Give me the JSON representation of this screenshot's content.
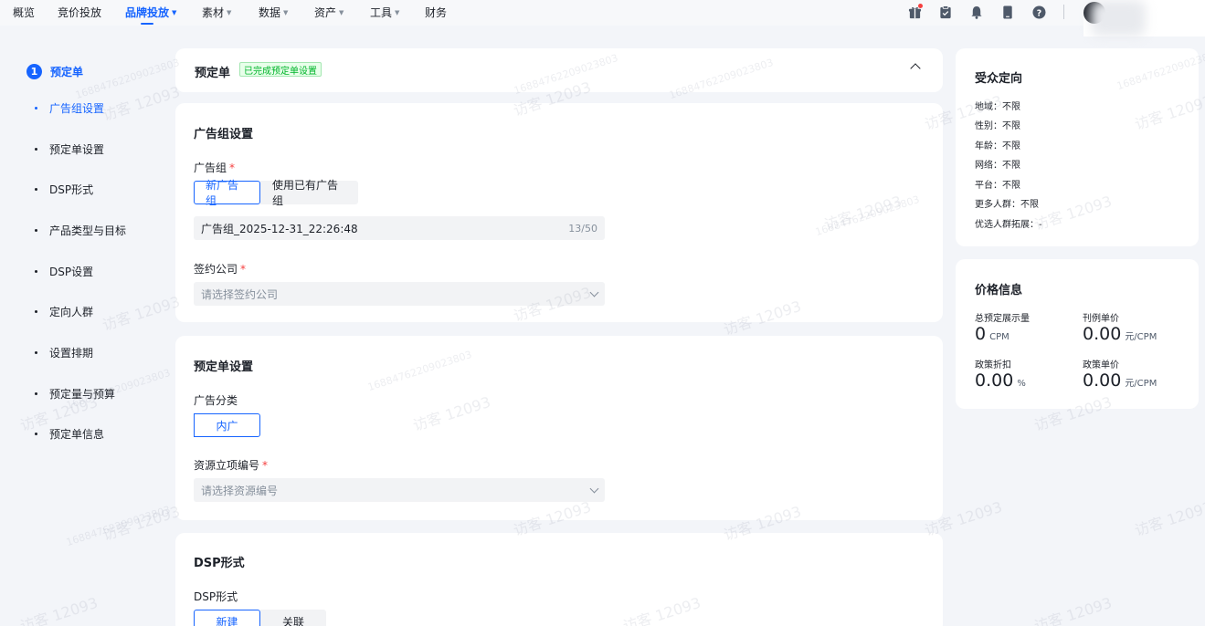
{
  "topnav": {
    "items": [
      {
        "label": "概览",
        "caret": false
      },
      {
        "label": "竞价投放",
        "caret": false
      },
      {
        "label": "品牌投放",
        "caret": true,
        "active": true
      },
      {
        "label": "素材",
        "caret": true
      },
      {
        "label": "数据",
        "caret": true
      },
      {
        "label": "资产",
        "caret": true
      },
      {
        "label": "工具",
        "caret": true
      },
      {
        "label": "财务",
        "caret": false
      }
    ],
    "icons": [
      "gift-icon",
      "clipboard-icon",
      "bell-icon",
      "phone-icon",
      "help-icon"
    ]
  },
  "steps": {
    "number": "1",
    "title": "预定单",
    "items": [
      "广告组设置",
      "预定单设置",
      "DSP形式",
      "产品类型与目标",
      "DSP设置",
      "定向人群",
      "设置排期",
      "预定量与预算",
      "预定单信息"
    ]
  },
  "order_header": {
    "title": "预定单",
    "status_tag": "已完成预定单设置"
  },
  "adgroup_card": {
    "title": "广告组设置",
    "adgroup_label": "广告组",
    "btn_new": "新广告组",
    "btn_existing": "使用已有广告组",
    "name_value": "广告组_2025-12-31_22:26:48",
    "name_count": "13/50",
    "company_label": "签约公司",
    "company_placeholder": "请选择签约公司"
  },
  "order_card": {
    "title": "预定单设置",
    "category_label": "广告分类",
    "category_value": "内广",
    "resource_label": "资源立项编号",
    "resource_placeholder": "请选择资源编号"
  },
  "dsp_card": {
    "title": "DSP形式",
    "field_label": "DSP形式",
    "btn_new": "新建",
    "btn_link": "关联"
  },
  "audience": {
    "title": "受众定向",
    "lines": [
      "地域：不限",
      "性别：不限",
      "年龄：不限",
      "网络：不限",
      "平台：不限",
      "更多人群：不限",
      "优选人群拓展：-"
    ]
  },
  "price": {
    "title": "价格信息",
    "total_label": "总预定展示量",
    "total_value": "0",
    "total_unit": "CPM",
    "list_label": "刊例单价",
    "list_value": "0.00",
    "list_unit": "元/CPM",
    "discount_label": "政策折扣",
    "discount_value": "0.00",
    "discount_unit": "%",
    "policy_label": "政策单价",
    "policy_value": "0.00",
    "policy_unit": "元/CPM"
  },
  "watermark": {
    "text": "访客 12093",
    "id": "16884762209023803"
  },
  "colors": {
    "primary": "#1664ff",
    "success": "#00b42a",
    "required": "#f53f3f",
    "background": "#f3f5f9"
  }
}
